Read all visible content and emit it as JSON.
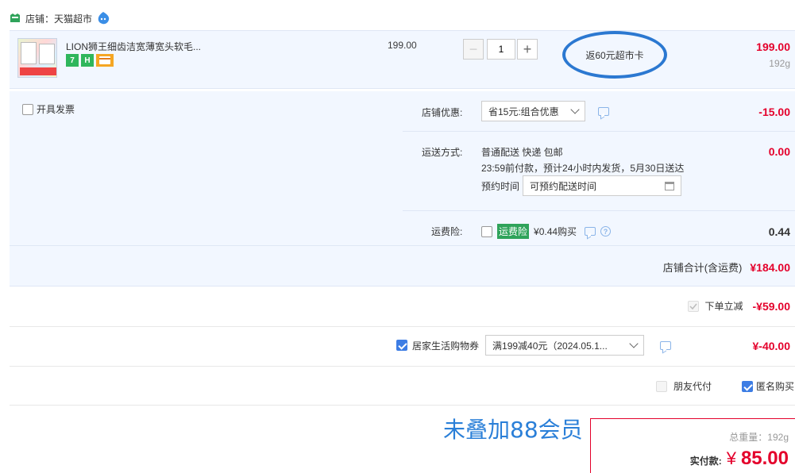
{
  "store": {
    "label": "店铺：天猫超市"
  },
  "item": {
    "title": "LION狮王细齿洁宽薄宽头软毛...",
    "unit_price": "199.00",
    "quantity": "1",
    "promo": "返60元超市卡",
    "total": "199.00",
    "weight": "192g",
    "badges": [
      "7",
      "H",
      ""
    ]
  },
  "invoice": {
    "label": "开具发票"
  },
  "shop_discount": {
    "label": "店铺优惠:",
    "selected": "省15元:组合优惠",
    "amount": "-15.00"
  },
  "delivery": {
    "label": "运送方式:",
    "line1": "普通配送 快递 包邮",
    "line2": "23:59前付款，预计24小时内发货，5月30日送达",
    "reserve_label": "预约时间",
    "reserve_placeholder": "可预约配送时间",
    "amount": "0.00"
  },
  "insurance": {
    "label": "运费险:",
    "tag": "运费险",
    "price": "¥0.44购买",
    "amount": "0.44"
  },
  "store_total": {
    "label": "店铺合计(含运费)",
    "amount": "¥184.00"
  },
  "order_discount": {
    "label": "下单立减",
    "amount": "-¥59.00"
  },
  "coupon": {
    "label": "居家生活购物券",
    "selected": "满199减40元（2024.05.1...",
    "amount": "¥-40.00"
  },
  "options": {
    "friend_pay": "朋友代付",
    "anonymous": "匿名购买"
  },
  "annotation": "未叠加88会员",
  "summary": {
    "weight": "总重量：192g",
    "pay_label": "实付款:",
    "currency": "¥",
    "amount": "85.00"
  },
  "colors": {
    "accent": "#e4002b",
    "blue": "#2b78d1",
    "bg": "#f2f7ff"
  }
}
